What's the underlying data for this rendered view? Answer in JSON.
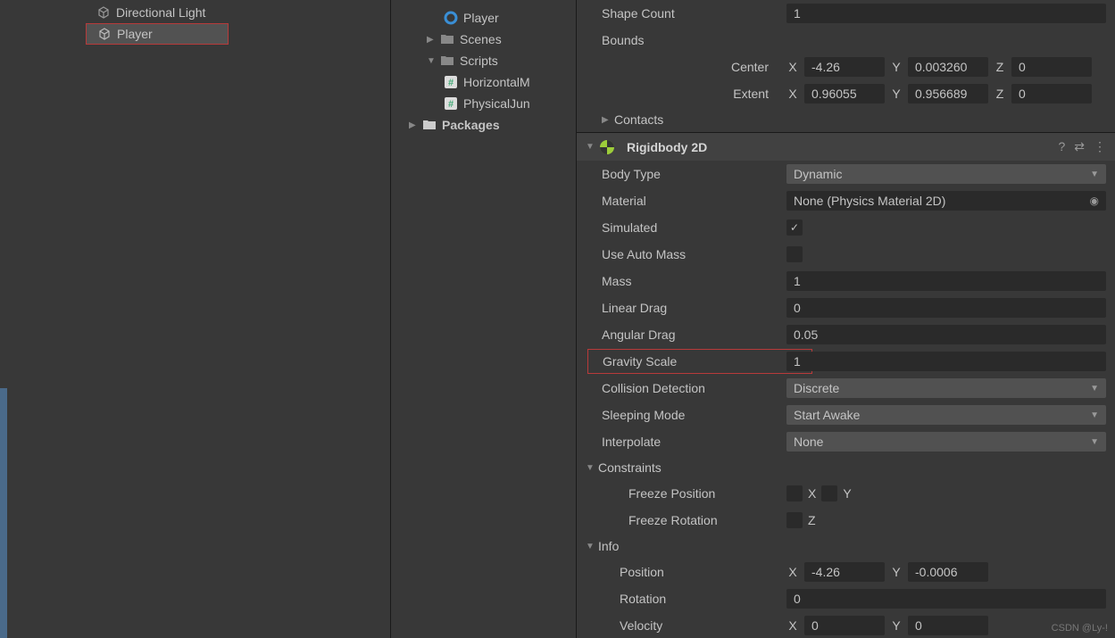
{
  "hierarchy": {
    "items": [
      {
        "label": "Directional Light",
        "icon": "cube",
        "selected": false
      },
      {
        "label": "Player",
        "icon": "cube",
        "selected": true
      }
    ]
  },
  "project": {
    "player_item": "Player",
    "scenes_label": "Scenes",
    "scripts_label": "Scripts",
    "script_items": [
      "HorizontalM",
      "PhysicalJun"
    ],
    "packages_label": "Packages"
  },
  "inspector": {
    "shape_count": {
      "label": "Shape Count",
      "value": "1"
    },
    "bounds_label": "Bounds",
    "center": {
      "label": "Center",
      "x": "-4.26",
      "y": "0.003260",
      "z": "0"
    },
    "extent": {
      "label": "Extent",
      "x": "0.96055",
      "y": "0.956689",
      "z": "0"
    },
    "contacts_label": "Contacts",
    "rigidbody": {
      "title": "Rigidbody 2D",
      "body_type": {
        "label": "Body Type",
        "value": "Dynamic"
      },
      "material": {
        "label": "Material",
        "value": "None (Physics Material 2D)"
      },
      "simulated": {
        "label": "Simulated",
        "checked": true
      },
      "use_auto_mass": {
        "label": "Use Auto Mass",
        "checked": false
      },
      "mass": {
        "label": "Mass",
        "value": "1"
      },
      "linear_drag": {
        "label": "Linear Drag",
        "value": "0"
      },
      "angular_drag": {
        "label": "Angular Drag",
        "value": "0.05"
      },
      "gravity_scale": {
        "label": "Gravity Scale",
        "value": "1"
      },
      "collision_detection": {
        "label": "Collision Detection",
        "value": "Discrete"
      },
      "sleeping_mode": {
        "label": "Sleeping Mode",
        "value": "Start Awake"
      },
      "interpolate": {
        "label": "Interpolate",
        "value": "None"
      },
      "constraints": {
        "label": "Constraints",
        "freeze_position": {
          "label": "Freeze Position",
          "x": false,
          "y": false
        },
        "freeze_rotation": {
          "label": "Freeze Rotation",
          "z": false
        }
      },
      "info": {
        "label": "Info",
        "position": {
          "label": "Position",
          "x": "-4.26",
          "y": "-0.0006"
        },
        "rotation": {
          "label": "Rotation",
          "value": "0"
        },
        "velocity": {
          "label": "Velocity",
          "x": "0",
          "y": "0"
        }
      }
    }
  },
  "watermark": "CSDN @Ly-!"
}
